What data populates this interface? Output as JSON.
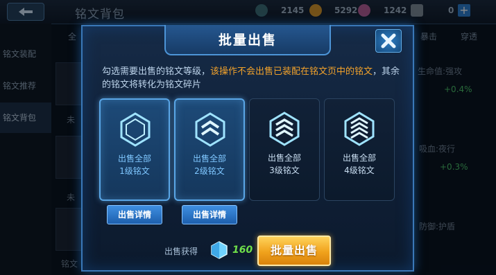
{
  "background": {
    "title": "铭文背包",
    "resources": [
      {
        "icon": "diamond-icon",
        "value": "2145"
      },
      {
        "icon": "gold-coin-icon",
        "value": "5292"
      },
      {
        "icon": "gem-icon",
        "value": "1242"
      },
      {
        "icon": "voucher-icon",
        "value": "0"
      }
    ],
    "sidebar": [
      {
        "label": "铭文装配",
        "active": false
      },
      {
        "label": "铭文推荐",
        "active": false
      },
      {
        "label": "铭文背包",
        "active": true
      }
    ],
    "tabs": [
      "全",
      "暴击",
      "穿透"
    ],
    "list_texts": [
      {
        "text": "生命值:强攻",
        "color": "gray"
      },
      {
        "text": "+0.4%",
        "color": "green"
      },
      {
        "text": "吸血:夜行",
        "color": "gray"
      },
      {
        "text": "+0.3%",
        "color": "green"
      },
      {
        "text": "防御:护盾",
        "color": "gray"
      },
      {
        "text": "未",
        "color": "gray"
      },
      {
        "text": "未",
        "color": "gray"
      },
      {
        "text": "铭文",
        "color": "gray"
      }
    ]
  },
  "dialog": {
    "title": "批量出售",
    "description_normal": "勾选需要出售的铭文等级，",
    "description_highlight": "该操作不会出售已装配在铭文页中的铭文",
    "description_tail": "，其余的铭文将转化为铭文碎片",
    "ranks": [
      {
        "line1": "出售全部",
        "line2": "1级铭文",
        "selected": true,
        "emblem": "rank-1-icon"
      },
      {
        "line1": "出售全部",
        "line2": "2级铭文",
        "selected": true,
        "emblem": "rank-2-icon"
      },
      {
        "line1": "出售全部",
        "line2": "3级铭文",
        "selected": false,
        "emblem": "rank-3-icon"
      },
      {
        "line1": "出售全部",
        "line2": "4级铭文",
        "selected": false,
        "emblem": "rank-4-icon"
      }
    ],
    "detail_button_label": "出售详情",
    "gain_label": "出售获得",
    "gain_icon": "crystal-icon",
    "gain_value": "160",
    "sell_button_label": "批量出售"
  },
  "colors": {
    "accent_blue": "#3a78b8",
    "highlight_orange": "#f2a22b",
    "gain_green": "#6fe04a",
    "sell_gold": "#f0a21c"
  }
}
